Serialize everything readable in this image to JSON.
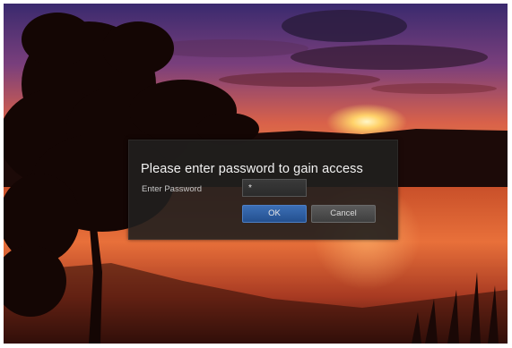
{
  "dialog": {
    "title": "Please enter password to gain access",
    "password_label": "Enter Password",
    "password_value": "*",
    "ok_label": "OK",
    "cancel_label": "Cancel"
  },
  "colors": {
    "ok_button": "#2f5fa3",
    "cancel_button": "#4a4a4a",
    "dialog_background": "#201f1e"
  }
}
